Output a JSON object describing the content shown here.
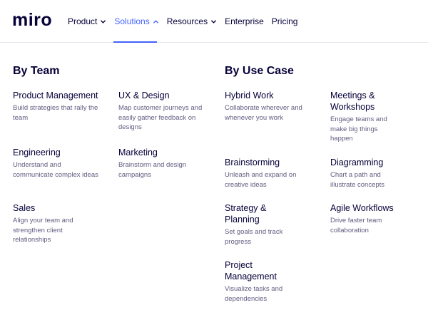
{
  "brand": {
    "logo_text": "miro"
  },
  "nav": {
    "items": [
      {
        "label": "Product",
        "has_chevron": true
      },
      {
        "label": "Solutions",
        "has_chevron": true,
        "active": true
      },
      {
        "label": "Resources",
        "has_chevron": true
      },
      {
        "label": "Enterprise",
        "has_chevron": false
      },
      {
        "label": "Pricing",
        "has_chevron": false
      }
    ],
    "active_color": "#4262ff"
  },
  "by_team": {
    "title": "By Team",
    "items": [
      {
        "title": "Product Management",
        "desc": "Build strategies that rally the team"
      },
      {
        "title": "UX & Design",
        "desc": "Map customer journeys and easily gather feedback on designs"
      },
      {
        "title": "Engineering",
        "desc": "Understand and communicate complex ideas"
      },
      {
        "title": "Marketing",
        "desc": "Brainstorm and design campaigns"
      },
      {
        "title": "Sales",
        "desc": "Align your team and strengthen client relationships"
      }
    ]
  },
  "by_use_case": {
    "title": "By Use Case",
    "items": [
      {
        "title": "Hybrid Work",
        "desc": "Collaborate wherever and whenever you work"
      },
      {
        "title": "Meetings & Workshops",
        "desc": "Engage teams and make big things happen"
      },
      {
        "title": "Brainstorming",
        "desc": "Unleash and expand on creative ideas"
      },
      {
        "title": "Diagramming",
        "desc": "Chart a path and illustrate concepts"
      },
      {
        "title": "Strategy & Planning",
        "desc": "Set goals and track progress"
      },
      {
        "title": "Agile Workflows",
        "desc": "Drive faster team collaboration"
      },
      {
        "title": "Project Management",
        "desc": "Visualize tasks and dependencies"
      }
    ]
  }
}
